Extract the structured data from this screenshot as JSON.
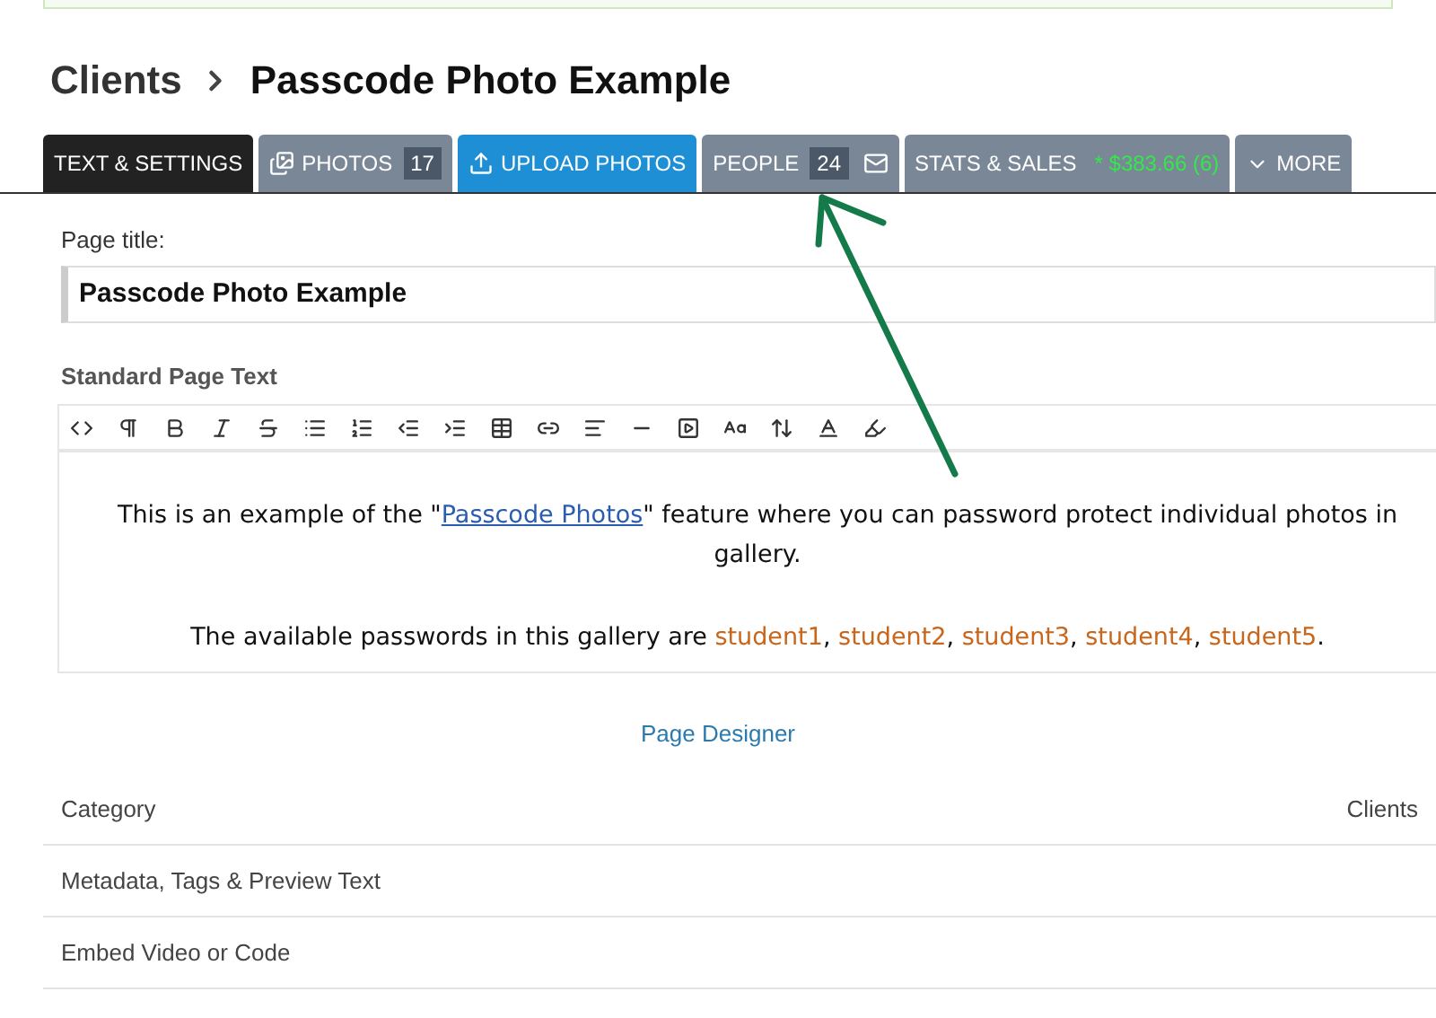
{
  "breadcrumb": {
    "parent": "Clients",
    "current": "Passcode Photo Example"
  },
  "tabs": [
    {
      "label": "TEXT & SETTINGS",
      "kind": "plain",
      "selected": true
    },
    {
      "label": "PHOTOS",
      "kind": "photos",
      "count": "17",
      "selected": false
    },
    {
      "label": "UPLOAD PHOTOS",
      "kind": "upload",
      "selected": false
    },
    {
      "label": "PEOPLE",
      "kind": "people",
      "count": "24",
      "selected": false
    },
    {
      "label": "STATS & SALES",
      "kind": "stats",
      "extra": "* $383.66 (6)",
      "selected": false
    },
    {
      "label": "MORE",
      "kind": "more",
      "selected": false
    }
  ],
  "page_title": {
    "label": "Page title:",
    "value": "Passcode Photo Example"
  },
  "editor": {
    "label": "Standard Page Text",
    "paragraphs": [
      [
        {
          "kind": "text",
          "text": "This is an example of the \""
        },
        {
          "kind": "link",
          "text": "Passcode Photos"
        },
        {
          "kind": "text",
          "text": "\" feature where you can password protect individual photos in gallery."
        }
      ],
      [
        {
          "kind": "rich",
          "text": "The available passwords in this gallery are **student1**, **student2**, **student3**, **student4**, **student5**."
        }
      ]
    ]
  },
  "page_designer": "Page Designer",
  "sections": [
    {
      "label": "Category",
      "value": "Clients"
    },
    {
      "label": "Metadata, Tags & Preview Text"
    },
    {
      "label": "Embed Video or Code"
    }
  ]
}
